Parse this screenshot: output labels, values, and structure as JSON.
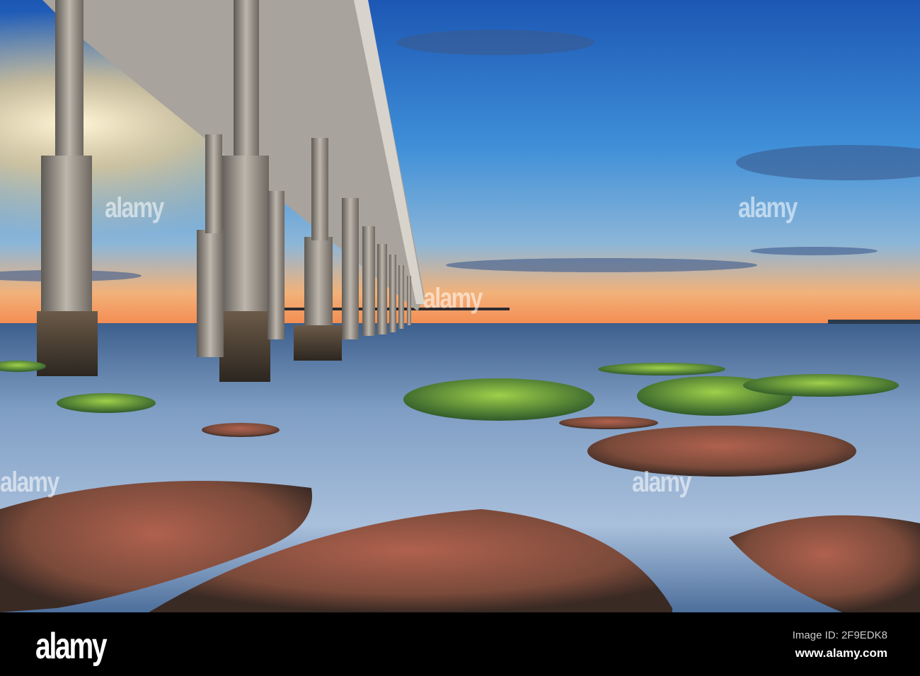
{
  "watermark": {
    "text": "alamy"
  },
  "footer": {
    "logo": "alamy",
    "image_id": "Image ID: 2F9EDK8",
    "website": "www.alamy.com"
  },
  "colors": {
    "sky_top": "#1f5fb8",
    "horizon": "#f29a52",
    "sea": "#5d7fa6"
  }
}
